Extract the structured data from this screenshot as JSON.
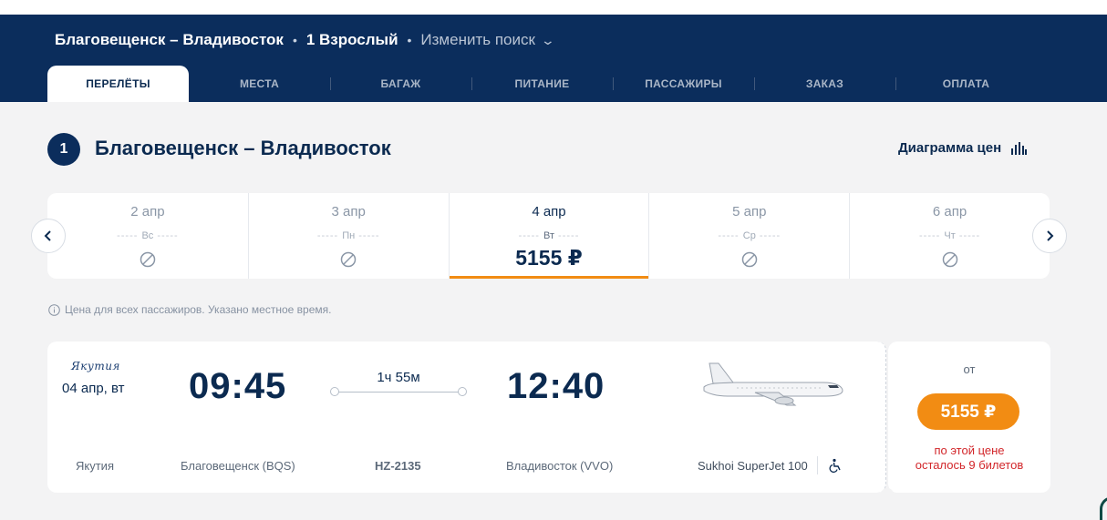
{
  "header": {
    "route": "Благовещенск – Владивосток",
    "passengers": "1 Взрослый",
    "change_search": "Изменить поиск",
    "separator": "•"
  },
  "tabs": [
    {
      "label": "ПЕРЕЛЁТЫ",
      "active": true
    },
    {
      "label": "МЕСТА",
      "active": false
    },
    {
      "label": "БАГАЖ",
      "active": false
    },
    {
      "label": "ПИТАНИЕ",
      "active": false
    },
    {
      "label": "ПАССАЖИРЫ",
      "active": false
    },
    {
      "label": "ЗАКАЗ",
      "active": false
    },
    {
      "label": "ОПЛАТА",
      "active": false
    }
  ],
  "section": {
    "step": "1",
    "title": "Благовещенск – Владивосток",
    "price_chart_label": "Диаграмма цен"
  },
  "dates": [
    {
      "date": "2 апр",
      "day": "Вс",
      "available": false
    },
    {
      "date": "3 апр",
      "day": "Пн",
      "available": false
    },
    {
      "date": "4 апр",
      "day": "Вт",
      "available": true,
      "price": "5155 ₽"
    },
    {
      "date": "5 апр",
      "day": "Ср",
      "available": false
    },
    {
      "date": "6 апр",
      "day": "Чт",
      "available": false
    }
  ],
  "info_note": "Цена для всех пассажиров. Указано местное время.",
  "flight": {
    "airline_logo_text": "Якутия",
    "airline": "Якутия",
    "date": "04 апр, вт",
    "departure_time": "09:45",
    "arrival_time": "12:40",
    "duration": "1ч 55м",
    "origin": "Благовещенск (BQS)",
    "destination": "Владивосток (VVO)",
    "flight_number": "HZ-2135",
    "aircraft": "Sukhoi SuperJet 100",
    "price_from_label": "от",
    "price": "5155 ₽",
    "price_note_line1": "по этой цене",
    "price_note_line2": "осталось 9 билетов"
  },
  "colors": {
    "header_bg": "#0b2d5c",
    "accent_orange": "#f28c13",
    "warning_red": "#d2262a",
    "page_bg": "#f3f3f4"
  }
}
